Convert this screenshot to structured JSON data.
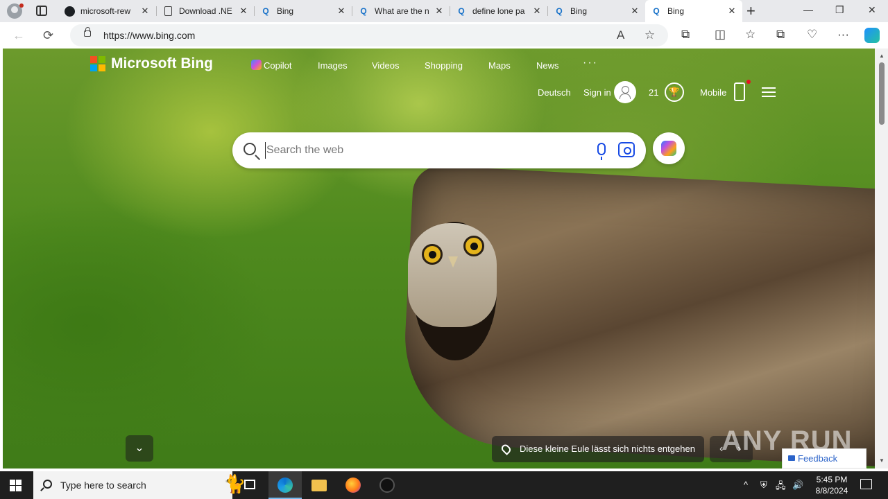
{
  "browser": {
    "tabs": [
      {
        "label": "microsoft-rew",
        "icon": "github-icon"
      },
      {
        "label": "Download .NE",
        "icon": "document-icon"
      },
      {
        "label": "Bing",
        "icon": "bing-search-icon"
      },
      {
        "label": "What are the n",
        "icon": "bing-search-icon"
      },
      {
        "label": "define lone pa",
        "icon": "bing-search-icon"
      },
      {
        "label": "Bing",
        "icon": "bing-search-icon"
      },
      {
        "label": "Bing",
        "icon": "bing-search-icon",
        "active": true
      }
    ],
    "close_glyph": "✕",
    "new_tab_glyph": "+",
    "window_controls": {
      "minimize": "—",
      "restore": "❐",
      "close": "✕"
    },
    "address": "https://www.bing.com"
  },
  "bing": {
    "logo_text": "Microsoft Bing",
    "logo_colors": [
      "#f25022",
      "#7fba00",
      "#00a4ef",
      "#ffb900"
    ],
    "nav": {
      "copilot": "Copilot",
      "images": "Images",
      "videos": "Videos",
      "shopping": "Shopping",
      "maps": "Maps",
      "news": "News",
      "more": "···"
    },
    "language": "Deutsch",
    "sign_in": "Sign in",
    "rewards_count": "21",
    "mobile": "Mobile",
    "search": {
      "placeholder": "Search the web",
      "value": ""
    },
    "caption": "Diese kleine Eule lässt sich nichts entgehen",
    "feedback": "Feedback",
    "watermark": "ANY RUN",
    "scroll_down_glyph": "⌄",
    "prev_glyph": "‹",
    "next_glyph": "›"
  },
  "taskbar": {
    "search_placeholder": "Type here to search",
    "time": "5:45 PM",
    "date": "8/8/2024",
    "tray": {
      "chevron": "^",
      "network": "🖧",
      "volume": "🔊"
    },
    "accent": "#76b9ed"
  }
}
